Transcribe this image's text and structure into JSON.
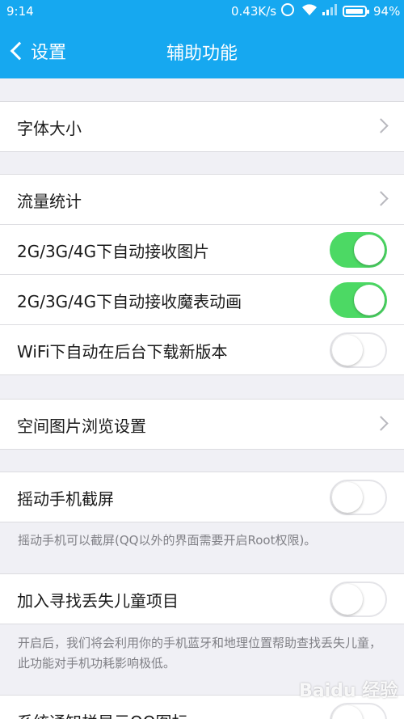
{
  "status_bar": {
    "time": "9:14",
    "speed": "0.43K/s",
    "battery_pct": "94%",
    "battery_level": 0.94,
    "icons": [
      "alarm-icon",
      "wifi-icon",
      "signal-icon",
      "battery-icon"
    ]
  },
  "nav": {
    "back_label": "设置",
    "title": "辅助功能"
  },
  "rows": {
    "font_size": "字体大小",
    "traffic": "流量统计",
    "auto_image": "2G/3G/4G下自动接收图片",
    "auto_magic": "2G/3G/4G下自动接收魔表动画",
    "wifi_download": "WiFi下自动在后台下载新版本",
    "album_settings": "空间图片浏览设置",
    "shake_screenshot": "摇动手机截屏",
    "lost_child": "加入寻找丢失儿童项目",
    "notification_icon": "系统通知栏显示QQ图标"
  },
  "toggles": {
    "auto_image": true,
    "auto_magic": true,
    "wifi_download": false,
    "shake_screenshot": false,
    "lost_child": false,
    "notification_icon": false
  },
  "descriptions": {
    "shake_screenshot": "摇动手机可以截屏(QQ以外的界面需要开启Root权限)。",
    "lost_child": "开启后，我们将会利用你的手机蓝牙和地理位置帮助查找丢失儿童，此功能对手机功耗影响极低。"
  },
  "watermark": "Baidu 经验",
  "colors": {
    "header_blue": "#16a8f0",
    "toggle_green": "#4cd964",
    "background": "#f0f0f5"
  }
}
